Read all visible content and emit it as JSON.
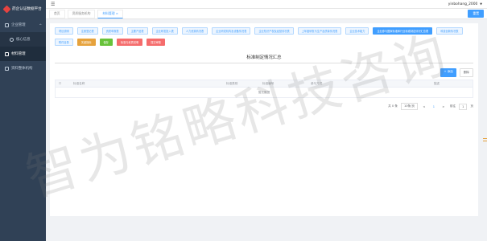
{
  "app": {
    "title": "药企认证数据平台"
  },
  "sidebar": {
    "items": [
      {
        "label": "企业管理",
        "arrow": "^"
      },
      {
        "label": "核心信息"
      },
      {
        "label": "材料管理"
      },
      {
        "label": "资料整体机构"
      }
    ]
  },
  "topbar": {
    "menu_icon": "hamburger-icon",
    "username": "yinbohang_2000"
  },
  "tabs": [
    {
      "label": "首页"
    },
    {
      "label": "资质服务机构"
    },
    {
      "label": "材料管理"
    }
  ],
  "reset_label": "重置",
  "buttons": [
    "项目说明",
    "注册登记表",
    "资质申报表",
    "主要产品表",
    "企业研发投入表",
    "人力资源情况表",
    "企业研发机构及设备情况表",
    "企业知识产权及经营情况表",
    "上年度研发与生产及质量情况表",
    "企业技术能力",
    "企业参与国家标准和行业标准制定情况汇总表",
    "科技创新情况表",
    "附件目录",
    "关键指标",
    "保存",
    "标准与资质说明",
    "提交审核"
  ],
  "section": {
    "title": "标准制定情况汇总"
  },
  "tools": {
    "add_label": "+ 添加",
    "delete_label": "删除"
  },
  "table": {
    "columns": [
      "",
      "标准名称",
      "标准类别",
      "标准编号",
      "参与方式",
      "描述"
    ],
    "empty_text": "暂无数据"
  },
  "pager": {
    "total": "共 0 条",
    "page_size": "10条/页",
    "prev": "<",
    "page": "1",
    "next": ">",
    "goto_label": "前往",
    "goto_value": "1",
    "page_suffix": "页"
  },
  "watermark": "智为铭略科技咨询",
  "colors": {
    "primary": "#409eff",
    "sidebar": "#304156",
    "orange": "#e6a23c",
    "green": "#67c23a",
    "red": "#f56c6c"
  }
}
